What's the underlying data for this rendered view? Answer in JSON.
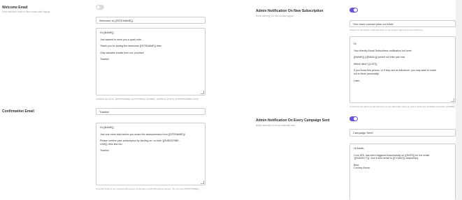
{
  "accent_color": "#6b52d8",
  "welcome": {
    "title": "Welcome Email",
    "description": "Send welcome email to new contact after signup",
    "toggle_on": false,
    "subject": "Welcome to {{SITENAME}}",
    "body_lines": [
      "Hi {{NAME}},",
      "Just wanted to send you a quick note...",
      "Thank you for joining the awesome {{SITENAME}} tribe.",
      "Only valuable emails from me, promise!",
      "Thanks!"
    ],
    "help": "Available tag words: {{FIRSTNAME}}, {{LASTNAME}}, {{NAME}}, {{EMAIL}}, {{LIST}}, {{UNSUBSCRIBE-LINK}}"
  },
  "confirmation": {
    "title": "Confirmation Email",
    "subject": "Thanks!",
    "body_lines": [
      "Hi {{NAME}},",
      "Just one more step before you share the awesomeness from {{SITENAME}}!",
      "Please confirm your subscription by clicking on <a href='{{SUBSCRIBE-",
      "LINK}}'>this link</a>",
      "Thanks!"
    ],
    "help": "If Double Optin is set, contacts will receive confirmation email with above content. You can use {{FIRSTNAME}}..."
  },
  "admin_subscription": {
    "title": "Admin Notification On New Subscription",
    "description": "Notify admin(s) for new contact signup",
    "toggle_on": true,
    "subject": "One more contact joins our tribe!",
    "field_help": "Subject for the admin email whenever a new contact signs up and is confirmed",
    "body_lines": [
      "Hi,",
      "Your friendly Email Subscribers notification bot here!",
      "{{NAME}} ({{EMAIL}}) joined our tribe just now.",
      "Which list/s? {{LIST}}",
      "If you know this person, or if they are an influencer, you may want to reach",
      "out to them personally!",
      "Later..."
    ],
    "help": "Content for the admin email whenever a new subscriber signs up and is confirmed. Available Keywords: {{NAME}}..."
  },
  "admin_campaign": {
    "title": "Admin Notification On Every Campaign Sent",
    "description": "Notify admin(s) on every campaign sent",
    "toggle_on": true,
    "subject": "Campaign Sent!",
    "body_lines": [
      "Hi Admin,",
      "Cron URL has been triggered successfully on {{DATE}} for the email",
      "'{{SUBJECT}}'. And it sent email to {{COUNT}} recipient(s).",
      "Best,",
      "Conney Arena"
    ]
  }
}
